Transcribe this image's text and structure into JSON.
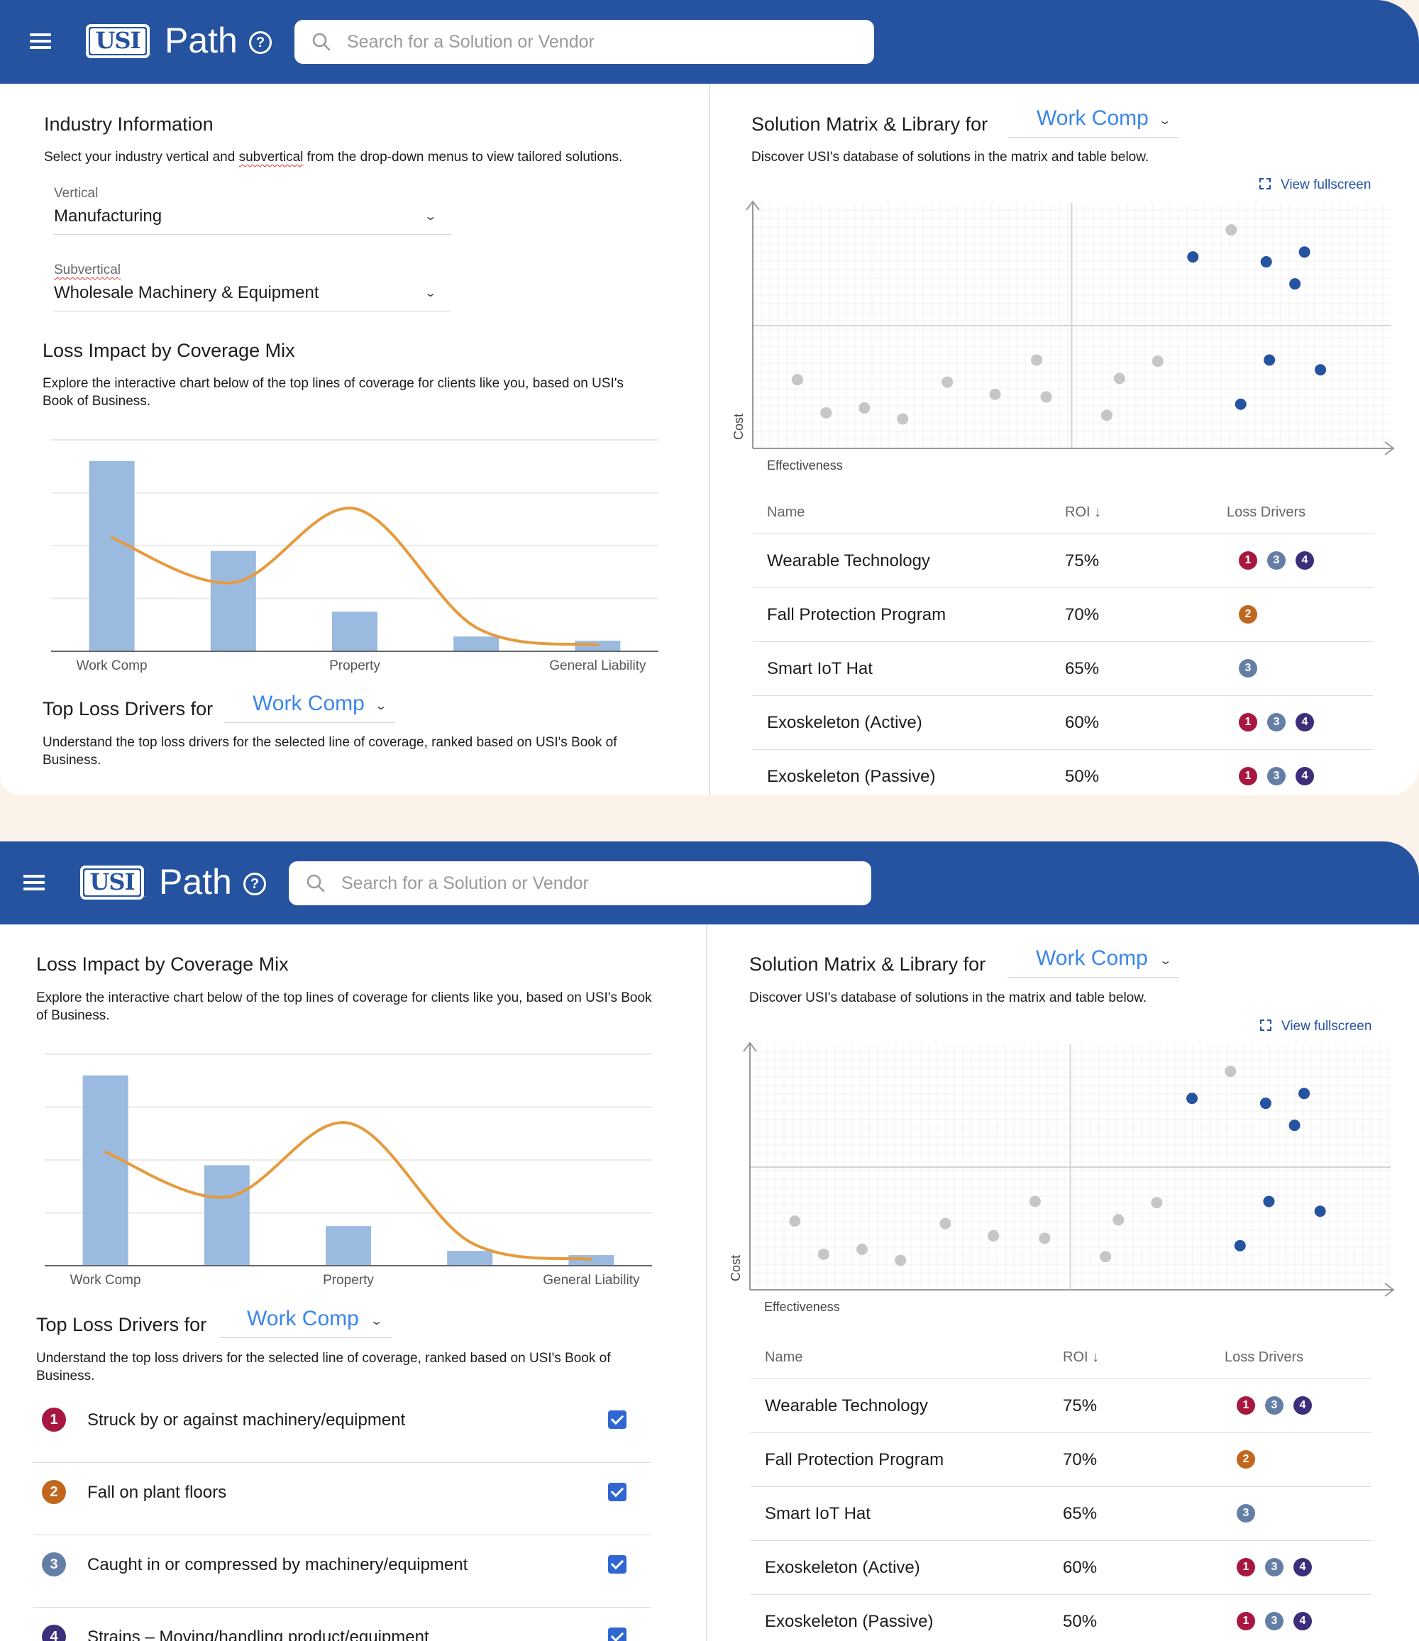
{
  "header": {
    "brand": "Path",
    "logo_text": "USI",
    "search_placeholder": "Search for a Solution or Vendor",
    "icons": [
      "menu-icon",
      "help-icon",
      "search-icon"
    ]
  },
  "industry": {
    "title": "Industry Information",
    "desc_before": "Select your industry vertical and ",
    "desc_flag": "subvertical",
    "desc_after": " from the drop-down menus to view tailored solutions.",
    "vertical_label": "Vertical",
    "vertical_value": "Manufacturing",
    "subvertical_label": "Subvertical",
    "subvertical_value": "Wholesale Machinery & Equipment"
  },
  "loss_impact": {
    "title": "Loss Impact by Coverage Mix",
    "desc": "Explore the interactive chart below of the top lines of coverage for clients like you, based on USI's Book of Business."
  },
  "top_drivers": {
    "title": "Top Loss Drivers for",
    "selected": "Work Comp",
    "desc": "Understand the top loss drivers for the selected line of coverage, ranked based on USI's Book of Business.",
    "items": [
      {
        "num": "1",
        "color": "#a8173f",
        "label": "Struck by or against machinery/equipment",
        "checked": true
      },
      {
        "num": "2",
        "color": "#c1671d",
        "label": "Fall on plant floors",
        "checked": true
      },
      {
        "num": "3",
        "color": "#647ea6",
        "label": "Caught in or compressed by machinery/equipment",
        "checked": true
      },
      {
        "num": "4",
        "color": "#3d2e7c",
        "label": "Strains – Moving/handling product/equipment",
        "checked": true
      }
    ]
  },
  "solution": {
    "title": "Solution Matrix & Library for",
    "selected": "Work Comp",
    "desc": "Discover USI's database of solutions in the matrix and table below.",
    "fullscreen": "View fullscreen",
    "y_label": "Cost",
    "x_label": "Effectiveness",
    "table_headers": {
      "name": "Name",
      "roi": "ROI",
      "drivers": "Loss Drivers",
      "sort": "↓"
    },
    "rows": [
      {
        "name": "Wearable Technology",
        "roi": "75%",
        "drivers": [
          "1",
          "3",
          "4"
        ]
      },
      {
        "name": "Fall Protection Program",
        "roi": "70%",
        "drivers": [
          "2"
        ]
      },
      {
        "name": "Smart IoT Hat",
        "roi": "65%",
        "drivers": [
          "3"
        ]
      },
      {
        "name": "Exoskeleton (Active)",
        "roi": "60%",
        "drivers": [
          "1",
          "3",
          "4"
        ]
      },
      {
        "name": "Exoskeleton (Passive)",
        "roi": "50%",
        "drivers": [
          "1",
          "3",
          "4"
        ]
      }
    ],
    "driver_colors": {
      "1": "#a8173f",
      "2": "#c1671d",
      "3": "#647ea6",
      "4": "#3d2e7c"
    }
  },
  "chart_data": [
    {
      "type": "bar",
      "categories": [
        "Work Comp",
        "",
        "Property",
        "",
        "General Liability"
      ],
      "values": [
        3.6,
        1.9,
        0.75,
        0.28,
        0.2
      ],
      "line": {
        "values": [
          2.15,
          1.3,
          2.7,
          0.45,
          0.12
        ],
        "color": "#e69a3c",
        "curve": "smooth"
      },
      "bar_color": "#9bbadf",
      "ylim": [
        0,
        4
      ],
      "grid": true,
      "title": "",
      "xlabel": "",
      "ylabel": ""
    },
    {
      "type": "scatter",
      "xlabel": "Effectiveness",
      "ylabel": "Cost",
      "xlim": [
        0,
        100
      ],
      "ylim": [
        0,
        100
      ],
      "quadrant_split": {
        "x": 50,
        "y": 50
      },
      "series": [
        {
          "color": "#2553a0",
          "points": [
            [
              69,
              78
            ],
            [
              80.5,
              76
            ],
            [
              86.5,
              80
            ],
            [
              85,
              67
            ],
            [
              81,
              36
            ],
            [
              89,
              32
            ],
            [
              76.5,
              18
            ]
          ]
        },
        {
          "color": "#c6c6c6",
          "points": [
            [
              7,
              28
            ],
            [
              11.5,
              14.5
            ],
            [
              17.5,
              16.5
            ],
            [
              23.5,
              12
            ],
            [
              30.5,
              27
            ],
            [
              38,
              22
            ],
            [
              44.5,
              36
            ],
            [
              46,
              21
            ],
            [
              55.5,
              13.5
            ],
            [
              57.5,
              28.5
            ],
            [
              63.5,
              35.5
            ],
            [
              75,
              89
            ]
          ]
        }
      ]
    }
  ]
}
